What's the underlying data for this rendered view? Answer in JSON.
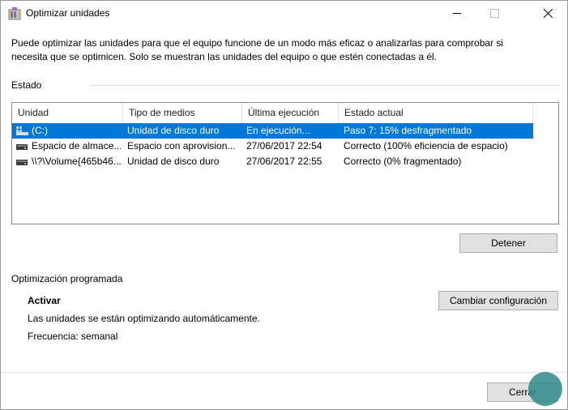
{
  "window": {
    "title": "Optimizar unidades",
    "description_line1": "Puede optimizar las unidades para que el equipo funcione de un modo más eficaz o analizarlas para comprobar si",
    "description_line2": "necesita que se optimicen. Solo se muestran las unidades del equipo o que estén conectadas a él."
  },
  "status_section": {
    "label": "Estado",
    "columns": [
      "Unidad",
      "Tipo de medios",
      "Última ejecución",
      "Estado actual"
    ],
    "rows": [
      {
        "unit": "(C:)",
        "media": "Unidad de disco duro",
        "last_run": "En ejecución...",
        "status": "Paso 7: 15% desfragmentado",
        "selected": true
      },
      {
        "unit": "Espacio de almace...",
        "media": "Espacio con aprovision...",
        "last_run": "27/06/2017 22:54",
        "status": "Correcto (100% eficiencia de espacio)",
        "selected": false
      },
      {
        "unit": "\\\\?\\Volume{465b46...",
        "media": "Unidad de disco duro",
        "last_run": "27/06/2017 22:55",
        "status": "Correcto (0% fragmentado)",
        "selected": false
      }
    ],
    "stop_button": "Detener"
  },
  "scheduled_section": {
    "label": "Optimización programada",
    "state": "Activar",
    "info": "Las unidades se están optimizando automáticamente.",
    "frequency": "Frecuencia: semanal",
    "change_settings_button": "Cambiar configuración"
  },
  "footer": {
    "close_button": "Cerrar"
  },
  "colors": {
    "selection": "#0078d7",
    "button_bg": "#e1e1e1"
  }
}
